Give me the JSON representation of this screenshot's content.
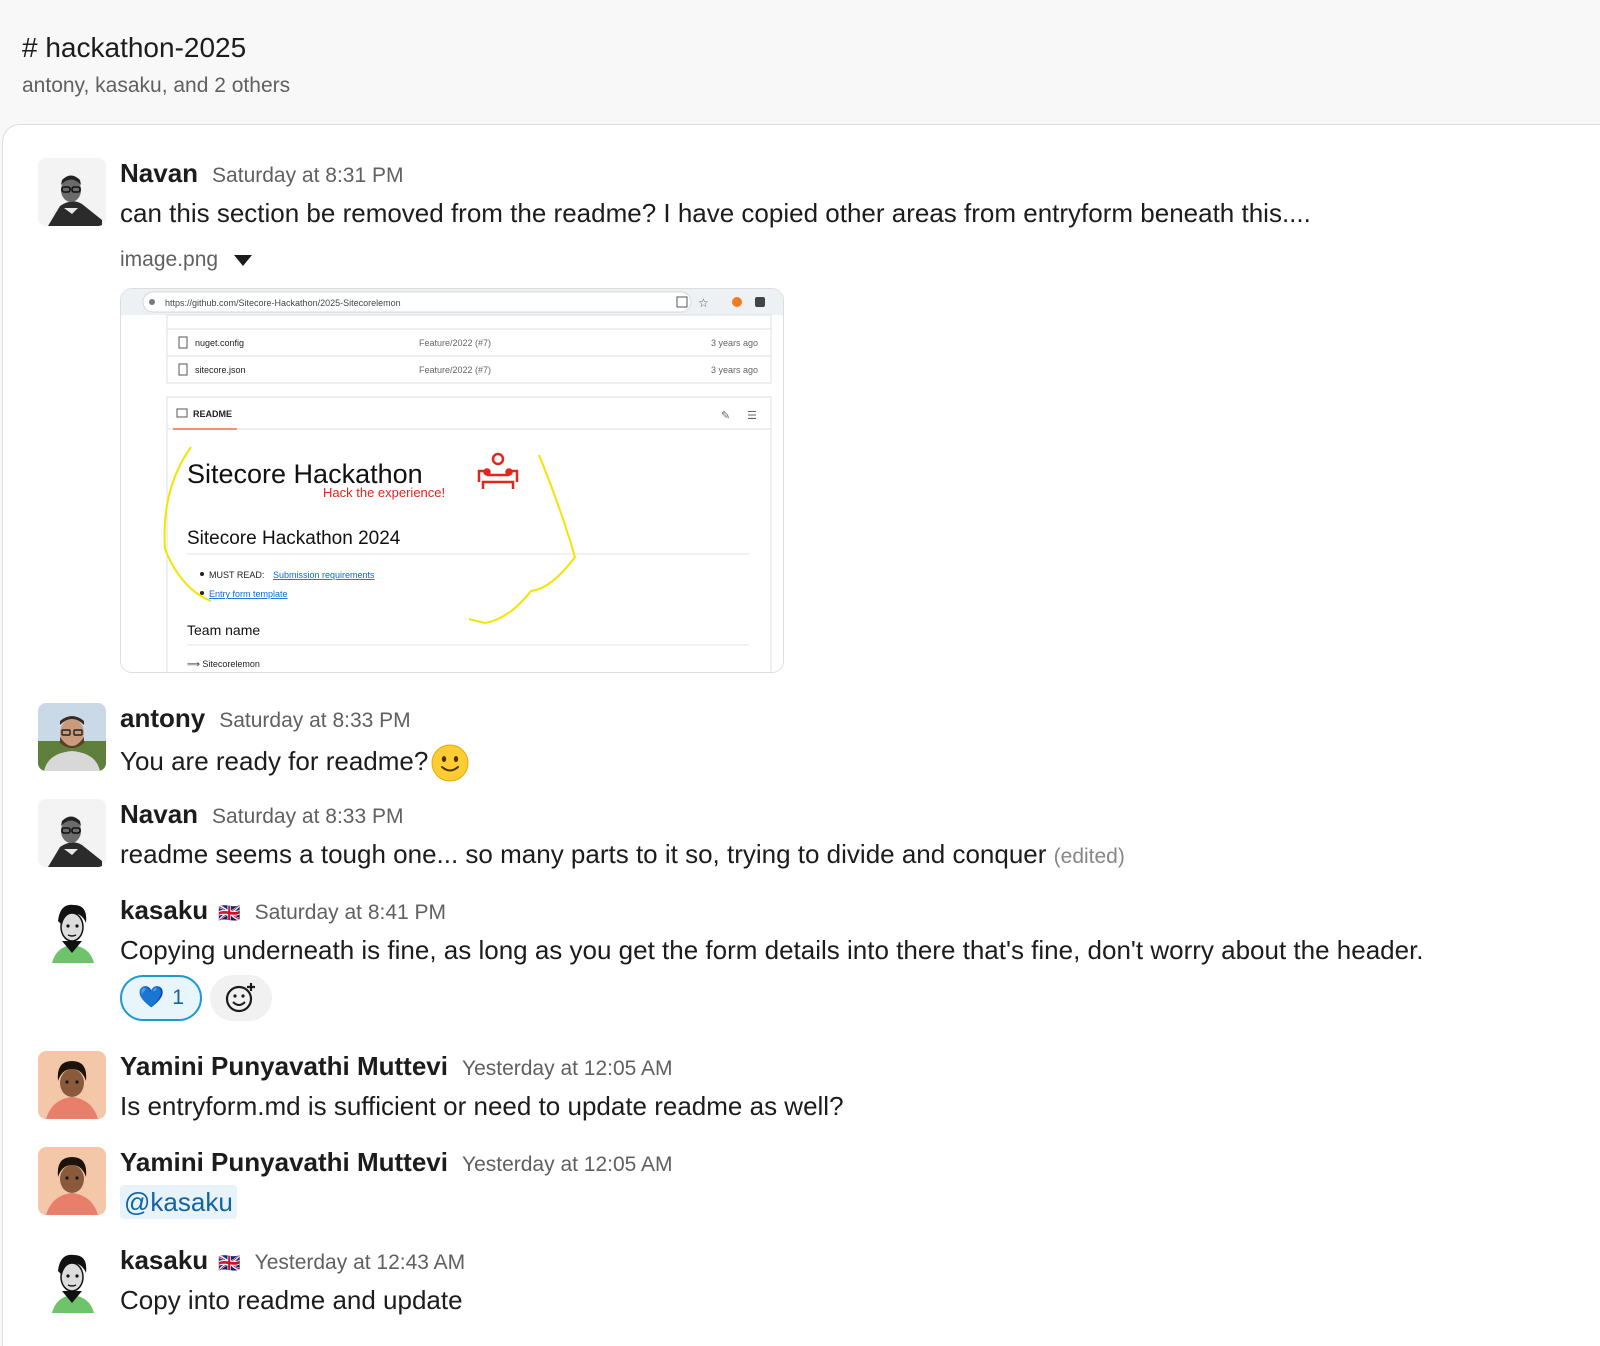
{
  "channel": {
    "title": "# hackathon-2025",
    "members": "antony, kasaku, and 2 others"
  },
  "messages": [
    {
      "author": "Navan",
      "time": "Saturday at 8:31 PM",
      "text": "can this section be removed from the readme? I have copied other areas from entryform beneath this....",
      "file_name": "image.png"
    },
    {
      "author": "antony",
      "time": "Saturday at 8:33 PM",
      "text": "You are ready for readme?"
    },
    {
      "author": "Navan",
      "time": "Saturday at 8:33 PM",
      "text": "readme seems a tough one... so many parts to it so, trying to divide and conquer",
      "edited": "(edited)"
    },
    {
      "author": "kasaku",
      "time": "Saturday at 8:41 PM",
      "text": "Copying underneath is fine, as long as you get the form details into there that's fine, don't worry about the header.",
      "reaction_emoji": "💙",
      "reaction_count": "1"
    },
    {
      "author": "Yamini Punyavathi Muttevi",
      "time": "Yesterday at 12:05 AM",
      "text": "Is entryform.md is sufficient or need to update readme as well?"
    },
    {
      "author": "Yamini Punyavathi Muttevi",
      "time": "Yesterday at 12:05 AM",
      "mention": "@kasaku"
    },
    {
      "author": "kasaku",
      "time": "Yesterday at 12:43 AM",
      "text": "Copy into readme and update"
    }
  ],
  "flag_emoji": "🇬🇧",
  "screenshot": {
    "url": "https://github.com/Sitecore-Hackathon/2025-Sitecorelemon",
    "files": [
      {
        "name": "nuget.config",
        "commit": "Feature/2022 (#7)",
        "age": "3 years ago"
      },
      {
        "name": "sitecore.json",
        "commit": "Feature/2022 (#7)",
        "age": "3 years ago"
      }
    ],
    "readme_tab": "README",
    "logo_title": "Sitecore Hackathon",
    "logo_tagline": "Hack the experience!",
    "heading": "Sitecore Hackathon 2024",
    "must_read": "MUST READ:",
    "link_submission": "Submission requirements",
    "link_entry": "Entry form template",
    "team_heading": "Team name",
    "team_value": "⟹ Sitecorelemon"
  },
  "colors": {
    "link": "#1264a3",
    "reaction_border": "#1d9bd1",
    "annotation": "#f5e400",
    "logo_red": "#e1261c"
  }
}
